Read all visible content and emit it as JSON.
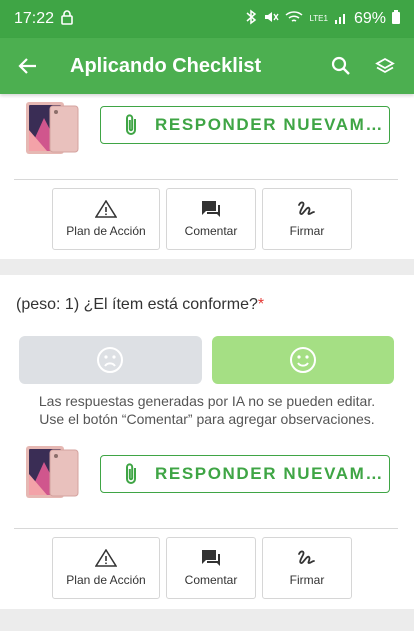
{
  "status": {
    "time": "17:22",
    "battery": "69%",
    "net": "LTE1"
  },
  "appbar": {
    "title": "Aplicando Checklist"
  },
  "respond_label": "RESPONDER NUEVAM…",
  "actions": {
    "plan": "Plan de Acción",
    "comment": "Comentar",
    "sign": "Firmar"
  },
  "question": {
    "text": "(peso: 1) ¿El ítem está conforme?",
    "required_mark": "*"
  },
  "notice": {
    "line1": "Las respuestas generadas por IA no se pueden editar.",
    "line2": "Use el botón “Comentar” para agregar observaciones."
  },
  "colors": {
    "primary": "#4caf50",
    "positive_answer": "#a5df84",
    "negative_answer": "#dde0e4",
    "required": "#e53935"
  }
}
